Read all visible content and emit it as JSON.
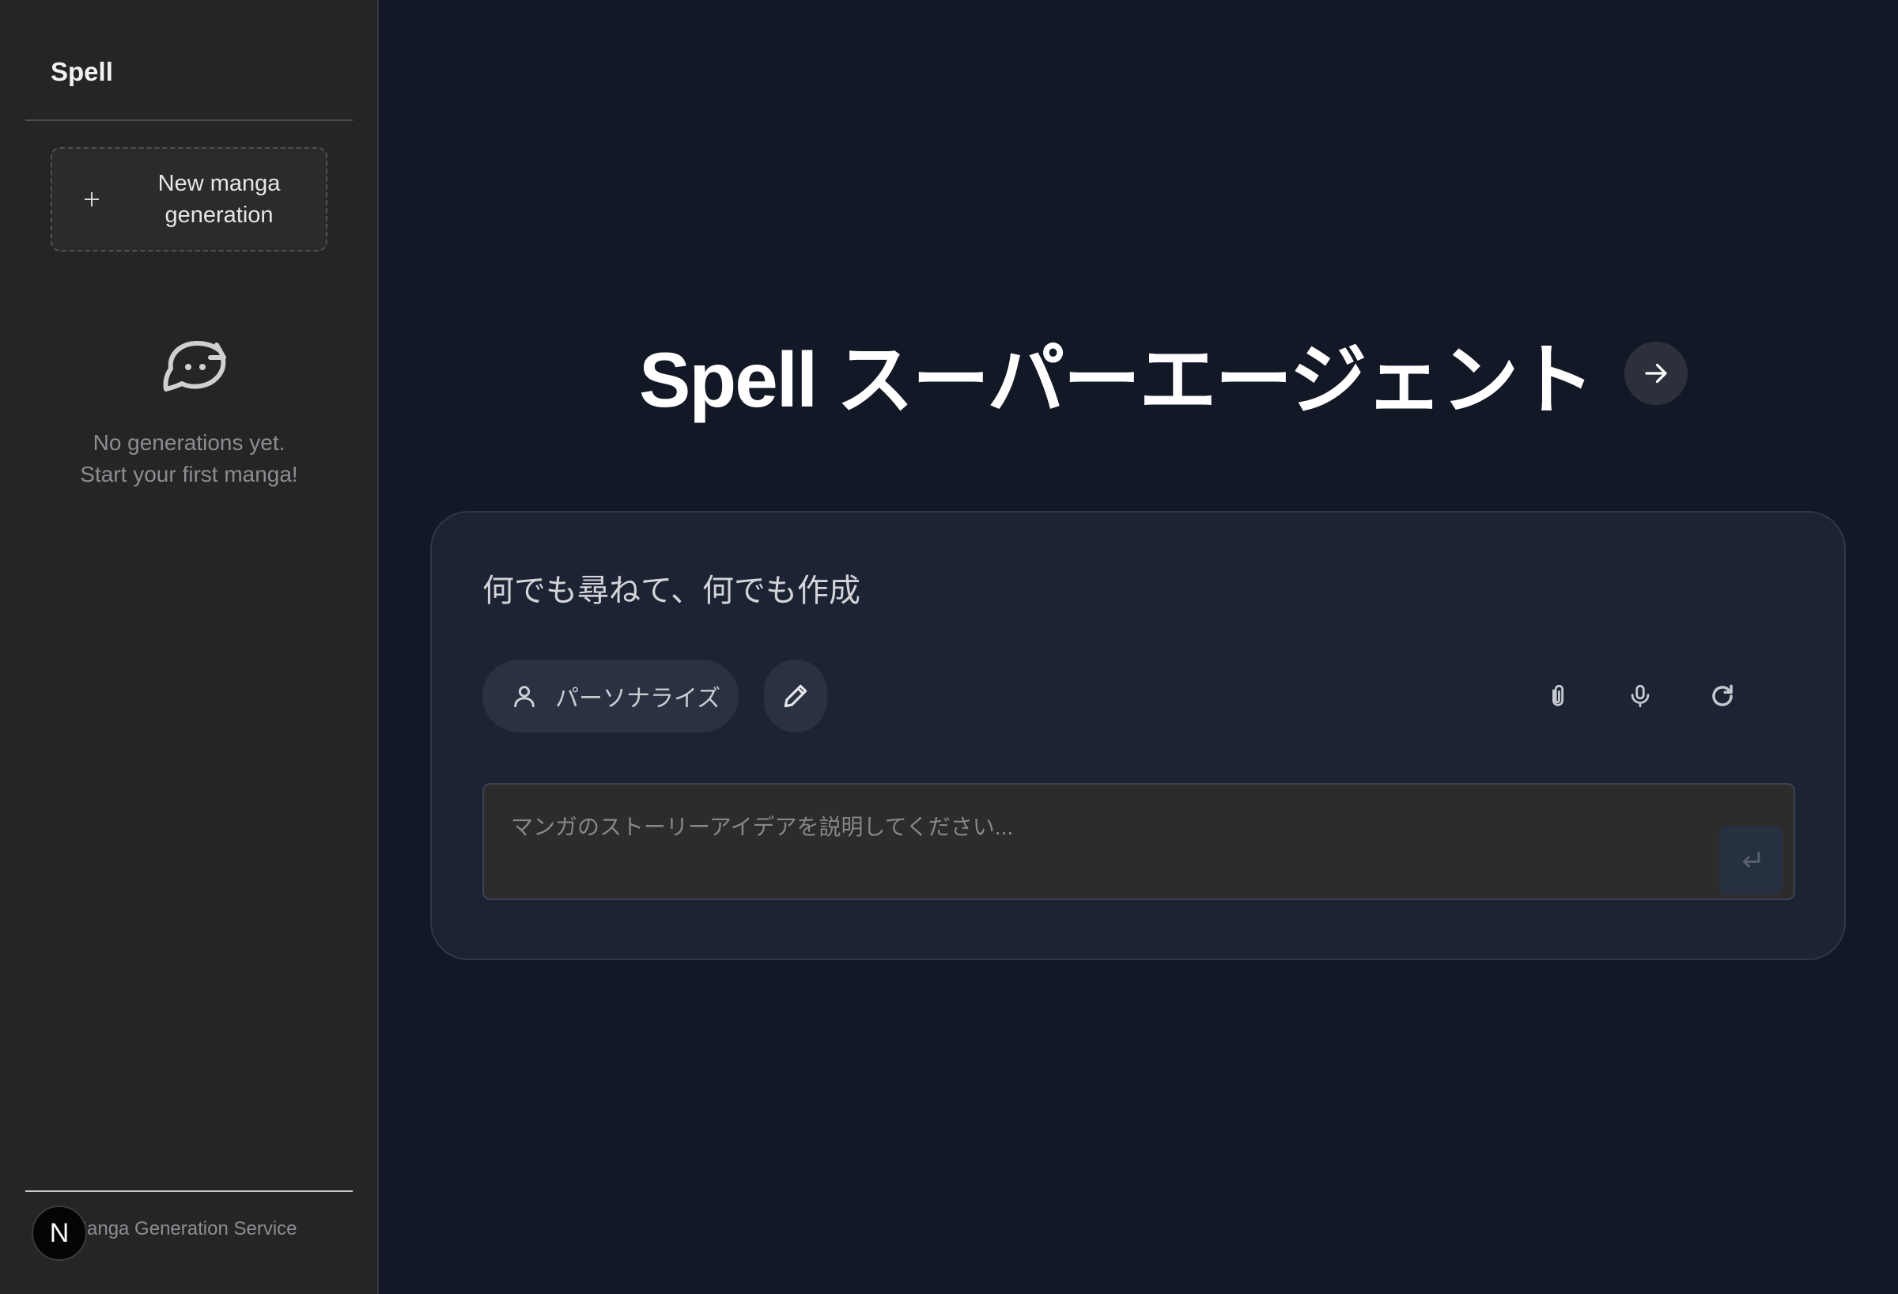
{
  "sidebar": {
    "brand": "Spell",
    "new_button_label": "New manga generation",
    "empty_message_line1": "No generations yet.",
    "empty_message_line2": "Start your first manga!",
    "footer_text": "Manga Generation Service",
    "avatar_letter": "N"
  },
  "main": {
    "title": "Spell スーパーエージェント",
    "card_heading": "何でも尋ねて、何でも作成",
    "personalize_label": "パーソナライズ",
    "prompt_placeholder": "マンガのストーリーアイデアを説明してください..."
  },
  "icons": {
    "new": "plus-icon",
    "empty": "chat-bubble-icon",
    "hero": "arrow-right-icon",
    "personalize": "user-icon",
    "edit": "pencil-icon",
    "attach": "paperclip-icon",
    "voice": "microphone-icon",
    "reset": "refresh-icon",
    "send": "enter-icon"
  }
}
